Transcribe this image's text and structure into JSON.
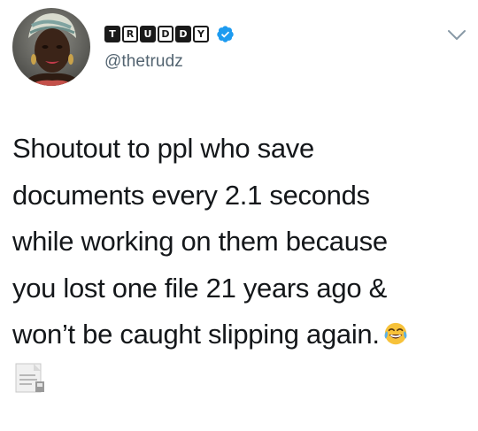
{
  "user": {
    "display_name_letters": [
      "T",
      "R",
      "U",
      "D",
      "D",
      "Y"
    ],
    "handle": "@thetrudz",
    "verified": true,
    "avatar_icon": "avatar-photo"
  },
  "tweet": {
    "lines": [
      "Shoutout to ppl who save",
      "documents every 2.1 seconds",
      "while working on them because",
      "you lost one file 21 years ago &",
      "won’t be caught slipping again."
    ],
    "emoji": "face-with-tears-of-joy",
    "attachment_icon": "document-icon"
  },
  "colors": {
    "text": "#14171a",
    "handle": "#536471",
    "verified": "#1d9bf0",
    "chevron": "#8899a6"
  }
}
